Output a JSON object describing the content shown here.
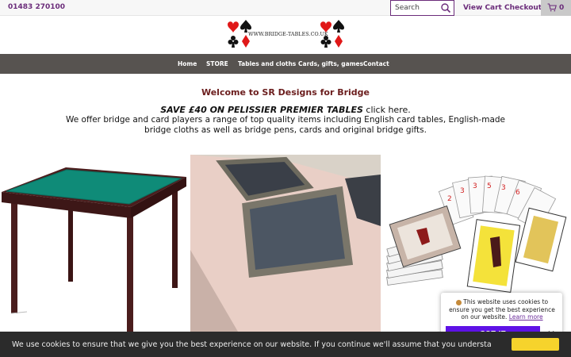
{
  "header": {
    "phone": "01483 270100",
    "search": {
      "placeholder": "Search"
    },
    "view_cart": "View Cart",
    "checkout": "Checkout",
    "cart_count": "0"
  },
  "logo": {
    "text": "WWW.BRIDGE-TABLES.CO.UK"
  },
  "nav": {
    "items": [
      "Home",
      "STORE",
      "Tables and cloths",
      "Cards, gifts, games",
      "Contact"
    ]
  },
  "main": {
    "welcome": "Welcome to SR Designs for Bridge",
    "promo_bold": "SAVE £40 ON PELISSIER PREMIER TABLES",
    "promo_link": "click here.",
    "intro": "We offer bridge and card players a range of top quality items including English  card tables, English-made bridge cloths as well as bridge pens, cards and original bridge gifts."
  },
  "cookie_popup": {
    "text": "This website uses cookies to ensure you get the best experience on our website.",
    "learn_more": "Learn more",
    "button": "GOT IT",
    "close": "✕"
  },
  "cookie_bar": {
    "text": "We use cookies to ensure that we give you the best experience on our website. If you continue we'll assume that you understa"
  },
  "colors": {
    "accent": "#6b2c7a",
    "nav_bg": "#575350",
    "welcome": "#6b1d1d",
    "got_it": "#5e12e6",
    "cookie_bar": "#2b2b2b"
  }
}
